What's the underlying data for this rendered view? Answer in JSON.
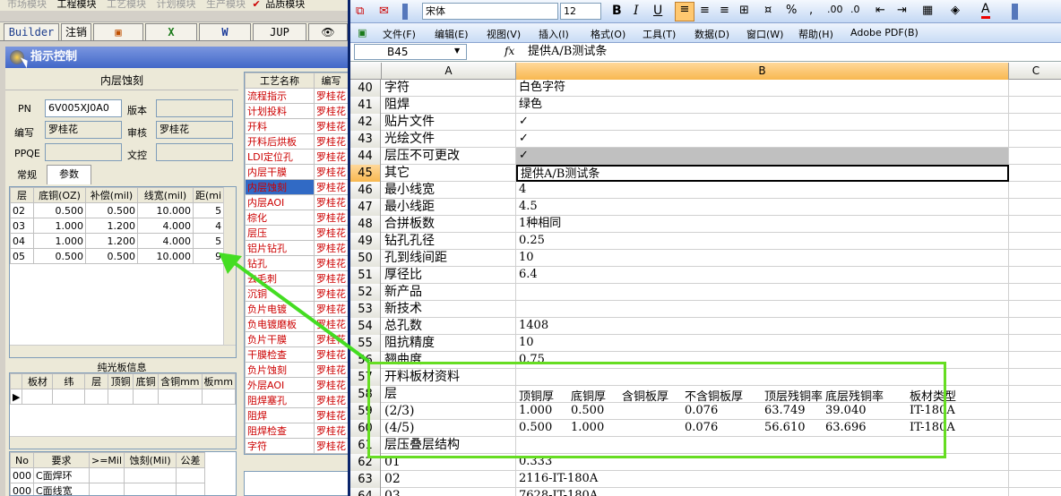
{
  "left": {
    "modules": [
      "市场模块",
      "工程模块",
      "工艺模块",
      "计划模块",
      "生产模块",
      "品质模块"
    ],
    "toolbar": {
      "builder": "Builder",
      "logout": "注销",
      "jup": "JUP"
    },
    "panel_title": "指示控制",
    "section_title": "内层蚀刻",
    "form": {
      "pn_label": "PN",
      "pn_value": "6V005XJ0A0",
      "version_label": "版本",
      "author_label": "编写",
      "author_value": "罗桂花",
      "review_label": "审核",
      "review_value": "罗桂花",
      "ppqe_label": "PPQE",
      "doc_label": "文控"
    },
    "tabs": [
      "常规",
      "参数"
    ],
    "layer_table": {
      "headers": [
        "层",
        "底铜(OZ)",
        "补偿(mil)",
        "线宽(mil)",
        "距(mi"
      ],
      "rows": [
        [
          "02",
          "0.500",
          "0.500",
          "10.000",
          "5"
        ],
        [
          "03",
          "1.000",
          "1.200",
          "4.000",
          "4"
        ],
        [
          "04",
          "1.000",
          "1.200",
          "4.000",
          "5"
        ],
        [
          "05",
          "0.500",
          "0.500",
          "10.000",
          "9"
        ]
      ]
    },
    "plate_title": "纯光板信息",
    "plate_headers": [
      "板材",
      "纬",
      "层",
      "顶铜",
      "底铜",
      "含铜mm",
      "板mm"
    ],
    "req_headers": [
      "No",
      "要求",
      ">=Mil",
      "蚀刻(Mil)",
      "公差"
    ],
    "req_rows": [
      [
        "000",
        "C面焊环"
      ],
      [
        "000",
        "C面线宽"
      ]
    ],
    "process_headers": [
      "工艺名称",
      "编写"
    ],
    "processes": [
      "流程指示",
      "计划投料",
      "开料",
      "开料后烘板",
      "LDI定位孔",
      "内层干膜",
      "内层蚀刻",
      "内层AOI",
      "棕化",
      "层压",
      "铝片钻孔",
      "钻孔",
      "去毛刺",
      "沉铜",
      "负片电镀",
      "负电镀磨板",
      "负片干膜",
      "干膜检查",
      "负片蚀刻",
      "外层AOI",
      "阻焊塞孔",
      "阻焊",
      "阻焊检查",
      "字符"
    ],
    "process_author": "罗桂花"
  },
  "excel": {
    "font": "宋体",
    "font_size": "12",
    "menu": [
      "文件(F)",
      "编辑(E)",
      "视图(V)",
      "插入(I)",
      "格式(O)",
      "工具(T)",
      "数据(D)",
      "窗口(W)",
      "帮助(H)",
      "Adobe PDF(B)"
    ],
    "name_box": "B45",
    "fx": "fx",
    "formula": "提供A/B测试条",
    "col_headers": [
      "A",
      "B",
      "C"
    ],
    "rows": [
      {
        "n": "40",
        "a": "字符",
        "b": "白色字符"
      },
      {
        "n": "41",
        "a": "阻焊",
        "b": "绿色"
      },
      {
        "n": "42",
        "a": "贴片文件",
        "b": "✓"
      },
      {
        "n": "43",
        "a": "光绘文件",
        "b": "✓"
      },
      {
        "n": "44",
        "a": "层压不可更改",
        "b": "✓"
      },
      {
        "n": "45",
        "a": "其它",
        "b": "提供A/B测试条"
      },
      {
        "n": "46",
        "a": "最小线宽",
        "b": "4"
      },
      {
        "n": "47",
        "a": "最小线距",
        "b": "4.5"
      },
      {
        "n": "48",
        "a": "合拼板数",
        "b": "1种相同"
      },
      {
        "n": "49",
        "a": "钻孔孔径",
        "b": "0.25"
      },
      {
        "n": "50",
        "a": "孔到线间距",
        "b": "10"
      },
      {
        "n": "51",
        "a": "厚径比",
        "b": "6.4"
      },
      {
        "n": "52",
        "a": "新产品",
        "b": ""
      },
      {
        "n": "53",
        "a": "新技术",
        "b": ""
      },
      {
        "n": "54",
        "a": "总孔数",
        "b": "1408"
      },
      {
        "n": "55",
        "a": "阻抗精度",
        "b": "10"
      },
      {
        "n": "56",
        "a": "翘曲度",
        "b": "0.75"
      },
      {
        "n": "57",
        "a": "开料板材资料",
        "b": ""
      },
      {
        "n": "58",
        "a": "层",
        "b": ""
      },
      {
        "n": "59",
        "a": "(2/3)",
        "b": ""
      },
      {
        "n": "60",
        "a": "(4/5)",
        "b": ""
      },
      {
        "n": "61",
        "a": "层压叠层结构",
        "b": ""
      },
      {
        "n": "62",
        "a": "01",
        "b": "0.333"
      },
      {
        "n": "63",
        "a": "02",
        "b": "2116-IT-180A"
      },
      {
        "n": "64",
        "a": "03",
        "b": "7628-IT-180A"
      }
    ],
    "sub_headers": [
      "顶铜厚",
      "底铜厚",
      "含铜板厚",
      "不含铜板厚",
      "顶层残铜率",
      "底层残铜率",
      "板材类型"
    ],
    "sub_rows": [
      [
        "1.000",
        "0.500",
        "",
        "0.076",
        "63.749",
        "39.040",
        "IT-180A"
      ],
      [
        "0.500",
        "1.000",
        "",
        "0.076",
        "56.610",
        "63.696",
        "IT-180A"
      ]
    ]
  }
}
